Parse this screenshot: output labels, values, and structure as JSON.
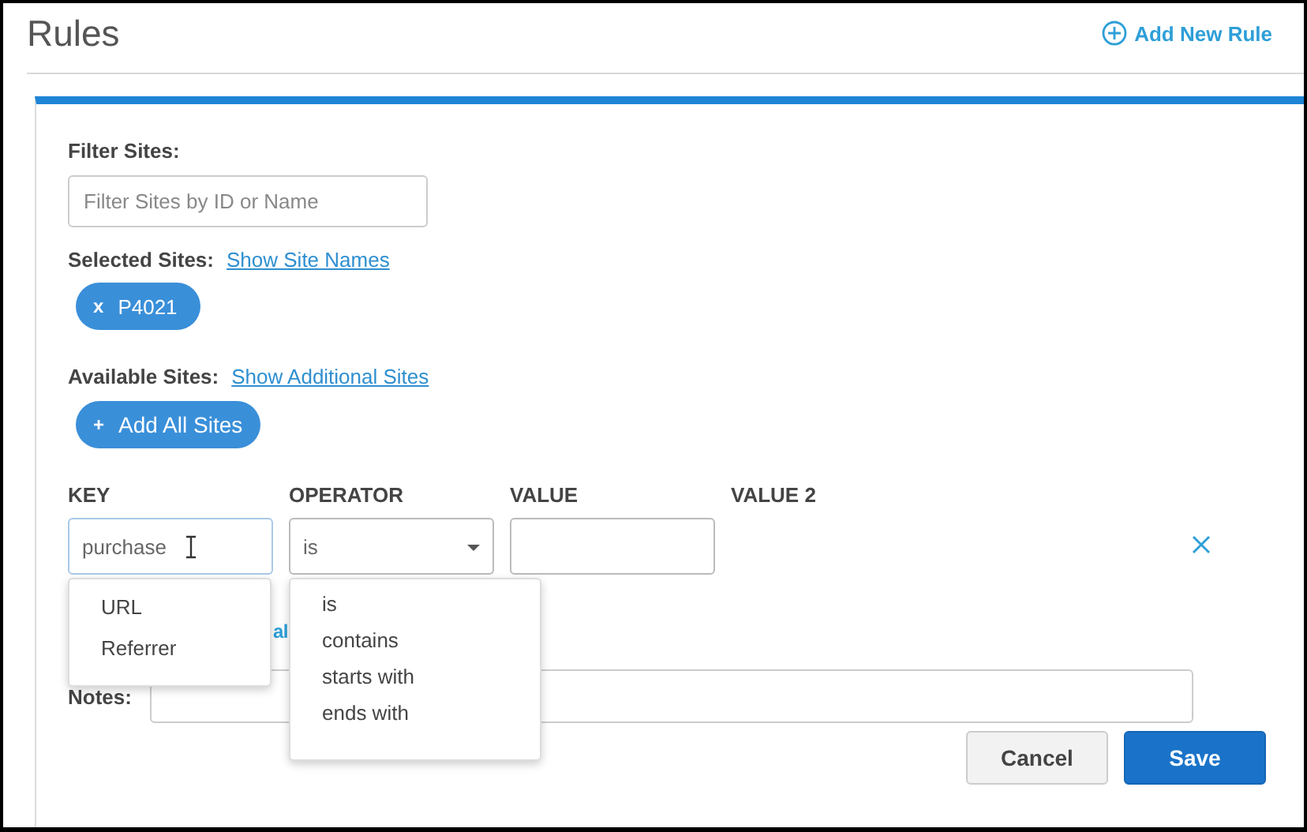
{
  "page": {
    "title": "Rules",
    "add_button": "Add New Rule"
  },
  "filter": {
    "label": "Filter Sites:",
    "placeholder": "Filter Sites by ID or Name"
  },
  "selected_sites": {
    "label": "Selected Sites:",
    "link": "Show Site Names",
    "chips": [
      "P4021"
    ],
    "chip_remove": "x"
  },
  "available_sites": {
    "label": "Available Sites:",
    "link": "Show Additional Sites",
    "button_icon": "+",
    "button": "Add All Sites"
  },
  "rule": {
    "columns": [
      "KEY",
      "OPERATOR",
      "VALUE",
      "VALUE 2"
    ],
    "key_value": "purchase",
    "operator_value": "is",
    "partial_link": "al"
  },
  "key_dropdown": [
    {
      "label": "URL"
    },
    {
      "label": "Referrer"
    }
  ],
  "operator_dropdown": [
    {
      "label": "is"
    },
    {
      "label": "contains"
    },
    {
      "label": "starts with"
    },
    {
      "label": "ends with"
    }
  ],
  "notes": {
    "label": "Notes:"
  },
  "buttons": [
    {
      "label": "Cancel",
      "kind": "secondary"
    },
    {
      "label": "Save",
      "kind": "primary"
    }
  ]
}
